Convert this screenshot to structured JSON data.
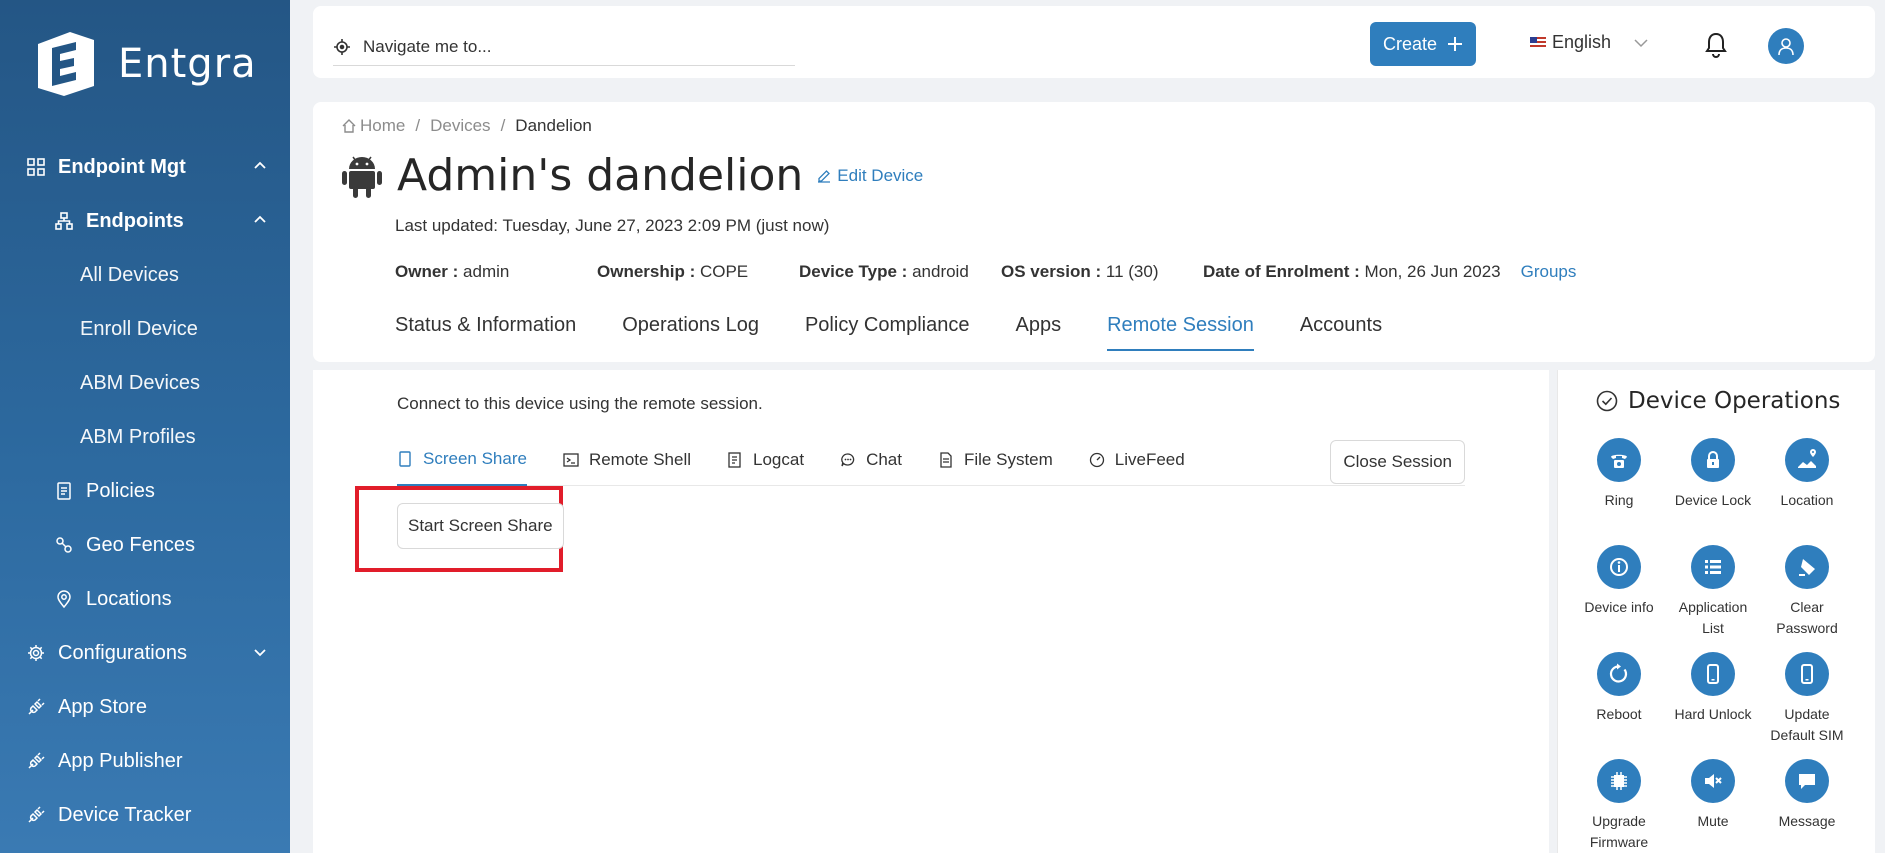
{
  "brand": {
    "name": "Entgra"
  },
  "sidebar": {
    "items": [
      {
        "label": "Endpoint Mgt",
        "icon": "grid-icon"
      },
      {
        "label": "Endpoints",
        "icon": "hierarchy-icon"
      },
      {
        "label": "All Devices"
      },
      {
        "label": "Enroll Device"
      },
      {
        "label": "ABM Devices"
      },
      {
        "label": "ABM Profiles"
      },
      {
        "label": "Policies",
        "icon": "policy-icon"
      },
      {
        "label": "Geo Fences",
        "icon": "geofence-icon"
      },
      {
        "label": "Locations",
        "icon": "location-pin-icon"
      },
      {
        "label": "Configurations",
        "icon": "gear-icon"
      },
      {
        "label": "App Store",
        "icon": "plug-icon"
      },
      {
        "label": "App Publisher",
        "icon": "plug-icon"
      },
      {
        "label": "Device Tracker",
        "icon": "plug-icon"
      }
    ]
  },
  "topbar": {
    "search_placeholder": "Navigate me to...",
    "create_label": "Create",
    "language": "English"
  },
  "breadcrumb": {
    "home": "Home",
    "devices": "Devices",
    "current": "Dandelion"
  },
  "device": {
    "name": "Admin's dandelion",
    "edit_label": "Edit Device",
    "last_updated": "Last updated: Tuesday, June 27, 2023 2:09 PM (just now)",
    "owner_label": "Owner :",
    "owner": "admin",
    "ownership_label": "Ownership :",
    "ownership": "COPE",
    "type_label": "Device Type :",
    "type": "android",
    "os_label": "OS version :",
    "os": "11 (30)",
    "enrol_label": "Date of Enrolment :",
    "enrol": "Mon, 26 Jun 2023",
    "groups_label": "Groups"
  },
  "tabs": [
    "Status & Information",
    "Operations Log",
    "Policy Compliance",
    "Apps",
    "Remote Session",
    "Accounts"
  ],
  "active_tab": "Remote Session",
  "remote": {
    "connect_text": "Connect to this device using the remote session.",
    "subtabs": [
      "Screen Share",
      "Remote Shell",
      "Logcat",
      "Chat",
      "File System",
      "LiveFeed"
    ],
    "close_label": "Close Session",
    "start_label": "Start Screen Share"
  },
  "ops": {
    "title": "Device Operations",
    "items": [
      "Ring",
      "Device Lock",
      "Location",
      "Device info",
      "Application List",
      "Clear Password",
      "Reboot",
      "Hard Unlock",
      "Update Default SIM",
      "Upgrade Firmware",
      "Mute",
      "Message"
    ]
  },
  "colors": {
    "accent": "#2f7ebd",
    "sidebar": "#2a6398",
    "highlight": "#e11d2a"
  }
}
